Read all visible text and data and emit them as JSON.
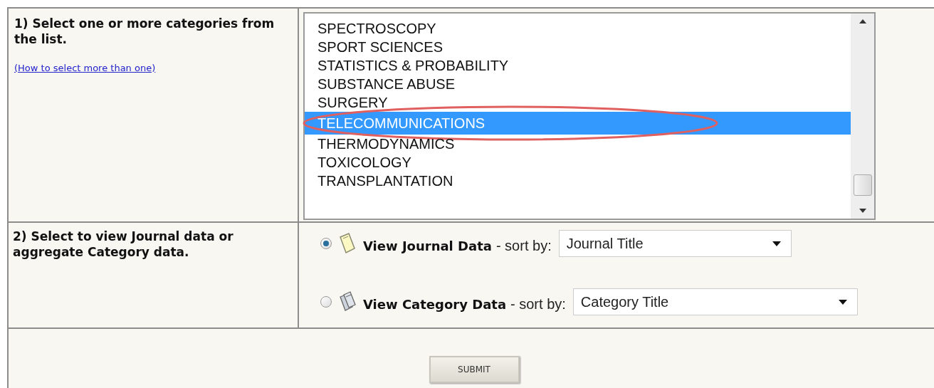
{
  "step_1": {
    "label": "1) Select one or more categories from the list.",
    "help_link": "(How to select more than one)"
  },
  "category_list": {
    "items": [
      {
        "label": "SPECTROSCOPY",
        "selected": false,
        "circled": false
      },
      {
        "label": "SPORT SCIENCES",
        "selected": false,
        "circled": false
      },
      {
        "label": "STATISTICS & PROBABILITY",
        "selected": false,
        "circled": false
      },
      {
        "label": "SUBSTANCE ABUSE",
        "selected": false,
        "circled": false
      },
      {
        "label": "SURGERY",
        "selected": false,
        "circled": false
      },
      {
        "label": "TELECOMMUNICATIONS",
        "selected": true,
        "circled": true
      },
      {
        "label": "THERMODYNAMICS",
        "selected": false,
        "circled": false
      },
      {
        "label": "TOXICOLOGY",
        "selected": false,
        "circled": false
      },
      {
        "label": "TRANSPLANTATION",
        "selected": false,
        "circled": false
      }
    ]
  },
  "step_2": {
    "label": "2) Select to view Journal data or aggregate Category data.",
    "options": [
      {
        "kind": "journal",
        "title": "View Journal Data",
        "suffix": "- sort by:",
        "sort_value": "Journal Title",
        "selected": true
      },
      {
        "kind": "category",
        "title": "View Category Data",
        "suffix": "- sort by:",
        "sort_value": "Category Title",
        "selected": false
      }
    ]
  },
  "submit": {
    "label": "SUBMIT"
  }
}
